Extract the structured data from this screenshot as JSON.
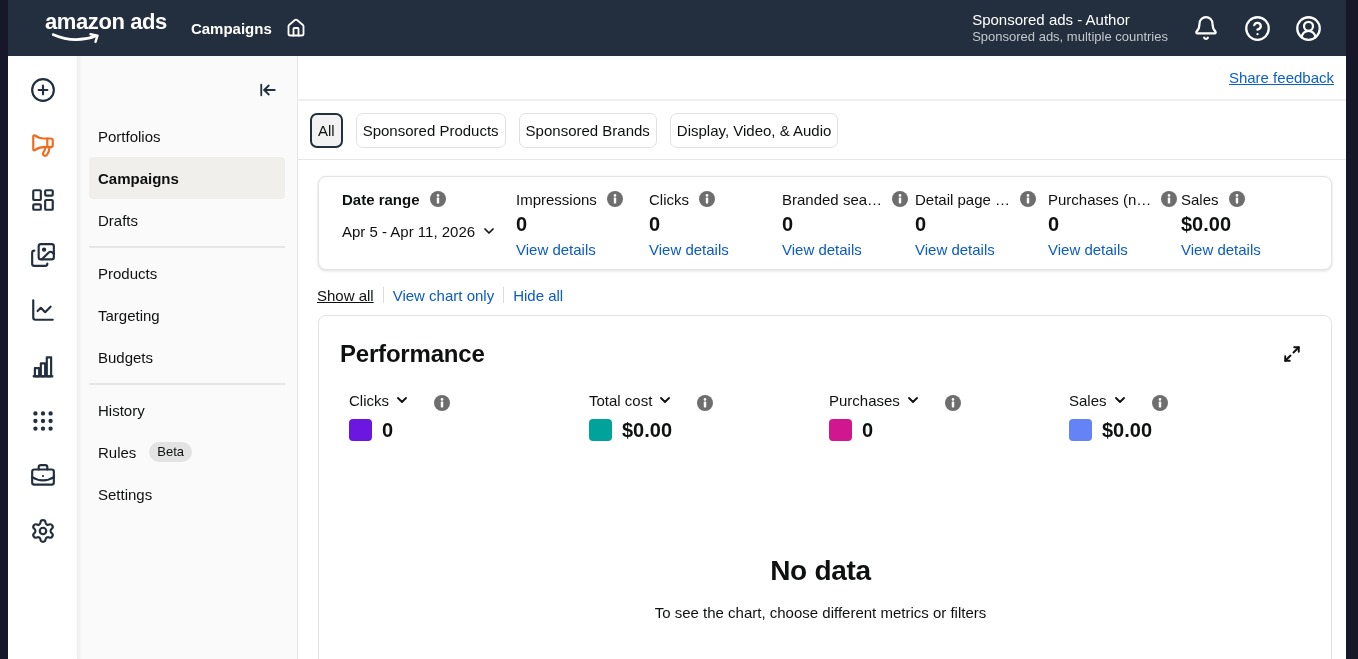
{
  "header": {
    "logo": "amazon ads",
    "title": "Campaigns",
    "account": {
      "name": "Sponsored ads - Author",
      "detail": "Sponsored ads, multiple countries"
    }
  },
  "icon_rail": [
    {
      "selected": false
    },
    {
      "selected": true
    },
    {
      "selected": false
    },
    {
      "selected": false
    },
    {
      "selected": false
    },
    {
      "selected": false
    },
    {
      "selected": false
    },
    {
      "selected": false
    },
    {
      "selected": false
    }
  ],
  "nav_groups": [
    {
      "items": [
        {
          "label": "Portfolios",
          "selected": false
        },
        {
          "label": "Campaigns",
          "selected": true
        },
        {
          "label": "Drafts",
          "selected": false
        }
      ]
    },
    {
      "items": [
        {
          "label": "Products",
          "selected": false
        },
        {
          "label": "Targeting",
          "selected": false
        },
        {
          "label": "Budgets",
          "selected": false
        }
      ]
    },
    {
      "items": [
        {
          "label": "History",
          "selected": false
        },
        {
          "label": "Rules",
          "selected": false,
          "badge": "Beta"
        },
        {
          "label": "Settings",
          "selected": false
        }
      ]
    }
  ],
  "share_feedback": "Share feedback",
  "tabs": [
    {
      "label": "All",
      "selected": true
    },
    {
      "label": "Sponsored Products",
      "selected": false
    },
    {
      "label": "Sponsored Brands",
      "selected": false
    },
    {
      "label": "Display, Video, & Audio",
      "selected": false
    }
  ],
  "summary": {
    "date_range": {
      "label": "Date range",
      "value": "Apr 5 - Apr 11, 2026"
    },
    "metrics": [
      {
        "label": "Impressions",
        "value": "0",
        "link": "View details"
      },
      {
        "label": "Clicks",
        "value": "0",
        "link": "View details"
      },
      {
        "label": "Branded sea…",
        "value": "0",
        "link": "View details"
      },
      {
        "label": "Detail page …",
        "value": "0",
        "link": "View details"
      },
      {
        "label": "Purchases (n…",
        "value": "0",
        "link": "View details"
      },
      {
        "label": "Sales",
        "value": "$0.00",
        "link": "View details"
      }
    ]
  },
  "view_options": [
    {
      "label": "Show all",
      "selected": true
    },
    {
      "label": "View chart only",
      "selected": false
    },
    {
      "label": "Hide all",
      "selected": false
    }
  ],
  "performance": {
    "title": "Performance",
    "metrics": [
      {
        "label": "Clicks",
        "value": "0",
        "color": "#6b17e0"
      },
      {
        "label": "Total cost",
        "value": "$0.00",
        "color": "#00a39a"
      },
      {
        "label": "Purchases",
        "value": "0",
        "color": "#d0178f"
      },
      {
        "label": "Sales",
        "value": "$0.00",
        "color": "#6483f7"
      }
    ],
    "empty_state": {
      "title": "No data",
      "message": "To see the chart, choose different metrics or filters"
    }
  }
}
